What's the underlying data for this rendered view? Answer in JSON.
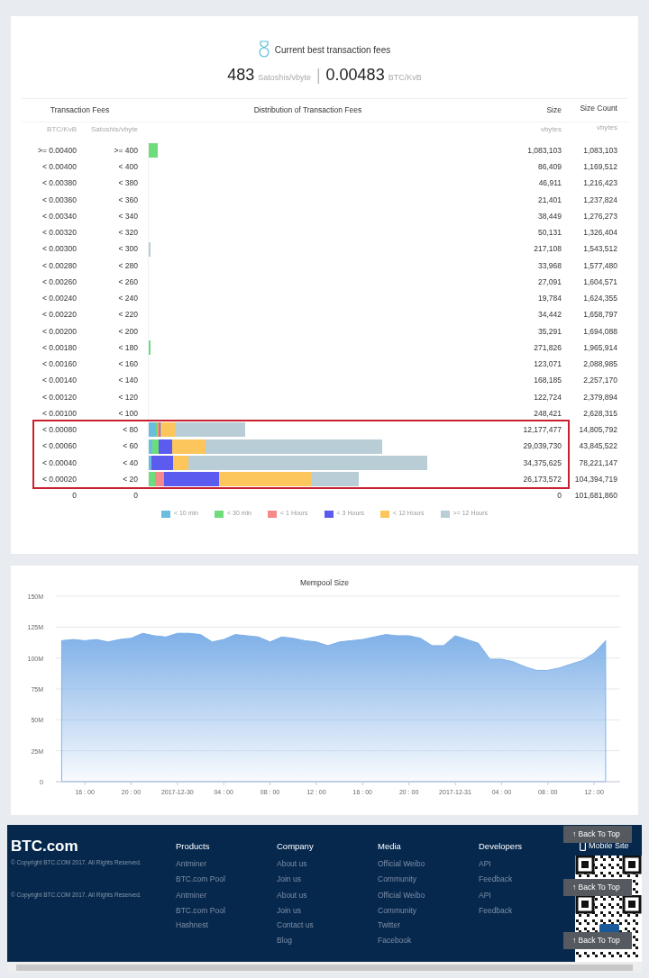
{
  "fee_summary": {
    "title": "Current best transaction fees",
    "satoshi_value": "483",
    "satoshi_unit": "Satoshis/vbyte",
    "separator": "|",
    "btc_value": "0.00483",
    "btc_unit": "BTC/KvB"
  },
  "fee_table": {
    "columns": [
      "Transaction Fees",
      "Distribution of Transaction Fees",
      "Size",
      "Size Count"
    ],
    "units": [
      "BTC/KvB",
      "Satoshis/vbyte",
      "vbytes",
      "vbytes"
    ],
    "rows": [
      {
        "btc_kvb": ">= 0.00400",
        "sat_vbyte": ">= 400",
        "size": "1,083,103",
        "size_count": "1,083,103",
        "highlighted": false
      },
      {
        "btc_kvb": "< 0.00400",
        "sat_vbyte": "< 400",
        "size": "86,409",
        "size_count": "1,169,512",
        "highlighted": false
      },
      {
        "btc_kvb": "< 0.00380",
        "sat_vbyte": "< 380",
        "size": "46,911",
        "size_count": "1,216,423",
        "highlighted": false
      },
      {
        "btc_kvb": "< 0.00360",
        "sat_vbyte": "< 360",
        "size": "21,401",
        "size_count": "1,237,824",
        "highlighted": false
      },
      {
        "btc_kvb": "< 0.00340",
        "sat_vbyte": "< 340",
        "size": "38,449",
        "size_count": "1,276,273",
        "highlighted": false
      },
      {
        "btc_kvb": "< 0.00320",
        "sat_vbyte": "< 320",
        "size": "50,131",
        "size_count": "1,326,404",
        "highlighted": false
      },
      {
        "btc_kvb": "< 0.00300",
        "sat_vbyte": "< 300",
        "size": "217,108",
        "size_count": "1,543,512",
        "highlighted": false
      },
      {
        "btc_kvb": "< 0.00280",
        "sat_vbyte": "< 280",
        "size": "33,968",
        "size_count": "1,577,480",
        "highlighted": false
      },
      {
        "btc_kvb": "< 0.00260",
        "sat_vbyte": "< 260",
        "size": "27,091",
        "size_count": "1,604,571",
        "highlighted": false
      },
      {
        "btc_kvb": "< 0.00240",
        "sat_vbyte": "< 240",
        "size": "19,784",
        "size_count": "1,624,355",
        "highlighted": false
      },
      {
        "btc_kvb": "< 0.00220",
        "sat_vbyte": "< 220",
        "size": "34,442",
        "size_count": "1,658,797",
        "highlighted": false
      },
      {
        "btc_kvb": "< 0.00200",
        "sat_vbyte": "< 200",
        "size": "35,291",
        "size_count": "1,694,088",
        "highlighted": false
      },
      {
        "btc_kvb": "< 0.00180",
        "sat_vbyte": "< 180",
        "size": "271,826",
        "size_count": "1,965,914",
        "highlighted": false
      },
      {
        "btc_kvb": "< 0.00160",
        "sat_vbyte": "< 160",
        "size": "123,071",
        "size_count": "2,088,985",
        "highlighted": false
      },
      {
        "btc_kvb": "< 0.00140",
        "sat_vbyte": "< 140",
        "size": "168,185",
        "size_count": "2,257,170",
        "highlighted": false
      },
      {
        "btc_kvb": "< 0.00120",
        "sat_vbyte": "< 120",
        "size": "122,724",
        "size_count": "2,379,894",
        "highlighted": false
      },
      {
        "btc_kvb": "< 0.00100",
        "sat_vbyte": "< 100",
        "size": "248,421",
        "size_count": "2,628,315",
        "highlighted": false
      },
      {
        "btc_kvb": "< 0.00080",
        "sat_vbyte": "< 80",
        "size": "12,177,477",
        "size_count": "14,805,792",
        "highlighted": true
      },
      {
        "btc_kvb": "< 0.00060",
        "sat_vbyte": "< 60",
        "size": "29,039,730",
        "size_count": "43,845,522",
        "highlighted": true
      },
      {
        "btc_kvb": "< 0.00040",
        "sat_vbyte": "< 40",
        "size": "34,375,625",
        "size_count": "78,221,147",
        "highlighted": true
      },
      {
        "btc_kvb": "< 0.00020",
        "sat_vbyte": "< 20",
        "size": "26,173,572",
        "size_count": "104,394,719",
        "highlighted": true
      },
      {
        "btc_kvb": "0",
        "sat_vbyte": "0",
        "size": "0",
        "size_count": "101,681,860",
        "highlighted": false
      }
    ],
    "legend": [
      {
        "label": "< 10 min",
        "color": "#6bbde0"
      },
      {
        "label": "< 30 min",
        "color": "#6fdc7c"
      },
      {
        "label": "< 1 Hours",
        "color": "#f48a8a"
      },
      {
        "label": "< 3 Hours",
        "color": "#5b5bf0"
      },
      {
        "label": "< 12 Hours",
        "color": "#fdc65c"
      },
      {
        "label": ">= 12 Hours",
        "color": "#b9cdd6"
      }
    ]
  },
  "mempool_chart": {
    "chart_data": {
      "type": "area",
      "title": "Mempool Size",
      "categories": [
        null,
        null,
        "16 : 00",
        null,
        null,
        null,
        "20 : 00",
        null,
        null,
        null,
        "2017-12-30",
        null,
        null,
        null,
        "04 : 00",
        null,
        null,
        null,
        "08 : 00",
        null,
        null,
        null,
        "12 : 00",
        null,
        null,
        null,
        "16 : 00",
        null,
        null,
        null,
        "20 : 00",
        null,
        null,
        null,
        "2017-12-31",
        null,
        null,
        null,
        "04 : 00",
        null,
        null,
        null,
        "08 : 00",
        null,
        null,
        null,
        "12 : 00",
        null
      ],
      "series": [
        {
          "color": "#7fb0e8",
          "values": [
            114,
            115,
            114,
            115,
            113,
            115,
            116,
            120,
            118,
            117,
            120,
            120,
            119,
            113,
            115,
            119,
            118,
            117,
            113,
            117,
            116,
            114,
            113,
            110,
            113,
            114,
            115,
            117,
            119,
            118,
            118,
            116,
            110,
            110,
            118,
            115,
            112,
            99,
            99,
            97,
            93,
            90,
            90,
            92,
            95,
            98,
            104,
            114
          ]
        }
      ],
      "ylim": [
        0,
        150
      ],
      "grid": true,
      "yticks": [
        {
          "value": 0,
          "label": "0"
        },
        {
          "value": 25,
          "label": "25M"
        },
        {
          "value": 50,
          "label": "50M"
        },
        {
          "value": 75,
          "label": "75M"
        },
        {
          "value": 100,
          "label": "100M"
        },
        {
          "value": 125,
          "label": "125M"
        },
        {
          "value": 150,
          "label": "150M"
        }
      ]
    }
  },
  "footer": {
    "brand": "BTC.com",
    "copyrights": [
      "© Copyright BTC.COM 2017. All Rights Reserved.",
      "© Copyright BTC.COM 2017. All Rights Reserved."
    ],
    "columns": [
      {
        "title": "Products",
        "links": [
          "Antminer",
          "BTC.com Pool"
        ],
        "links_repeat": [
          "Antminer",
          "BTC.com Pool",
          "Hashnest"
        ]
      },
      {
        "title": "Company",
        "links": [
          "About us",
          "Join us"
        ],
        "links_repeat": [
          "About us",
          "Join us",
          "Contact us",
          "Blog"
        ]
      },
      {
        "title": "Media",
        "links": [
          "Official Weibo",
          "Community"
        ],
        "links_repeat": [
          "Official Weibo",
          "Community",
          "Twitter",
          "Facebook"
        ]
      },
      {
        "title": "Developers",
        "links": [
          "API",
          "Feedback"
        ],
        "links_repeat": [
          "API",
          "Feedback"
        ]
      }
    ],
    "mobile_site": "Mobile Site",
    "back_to_top": [
      "↑ Back To Top",
      "↑ Back To Top",
      "↑ Back To Top"
    ]
  }
}
